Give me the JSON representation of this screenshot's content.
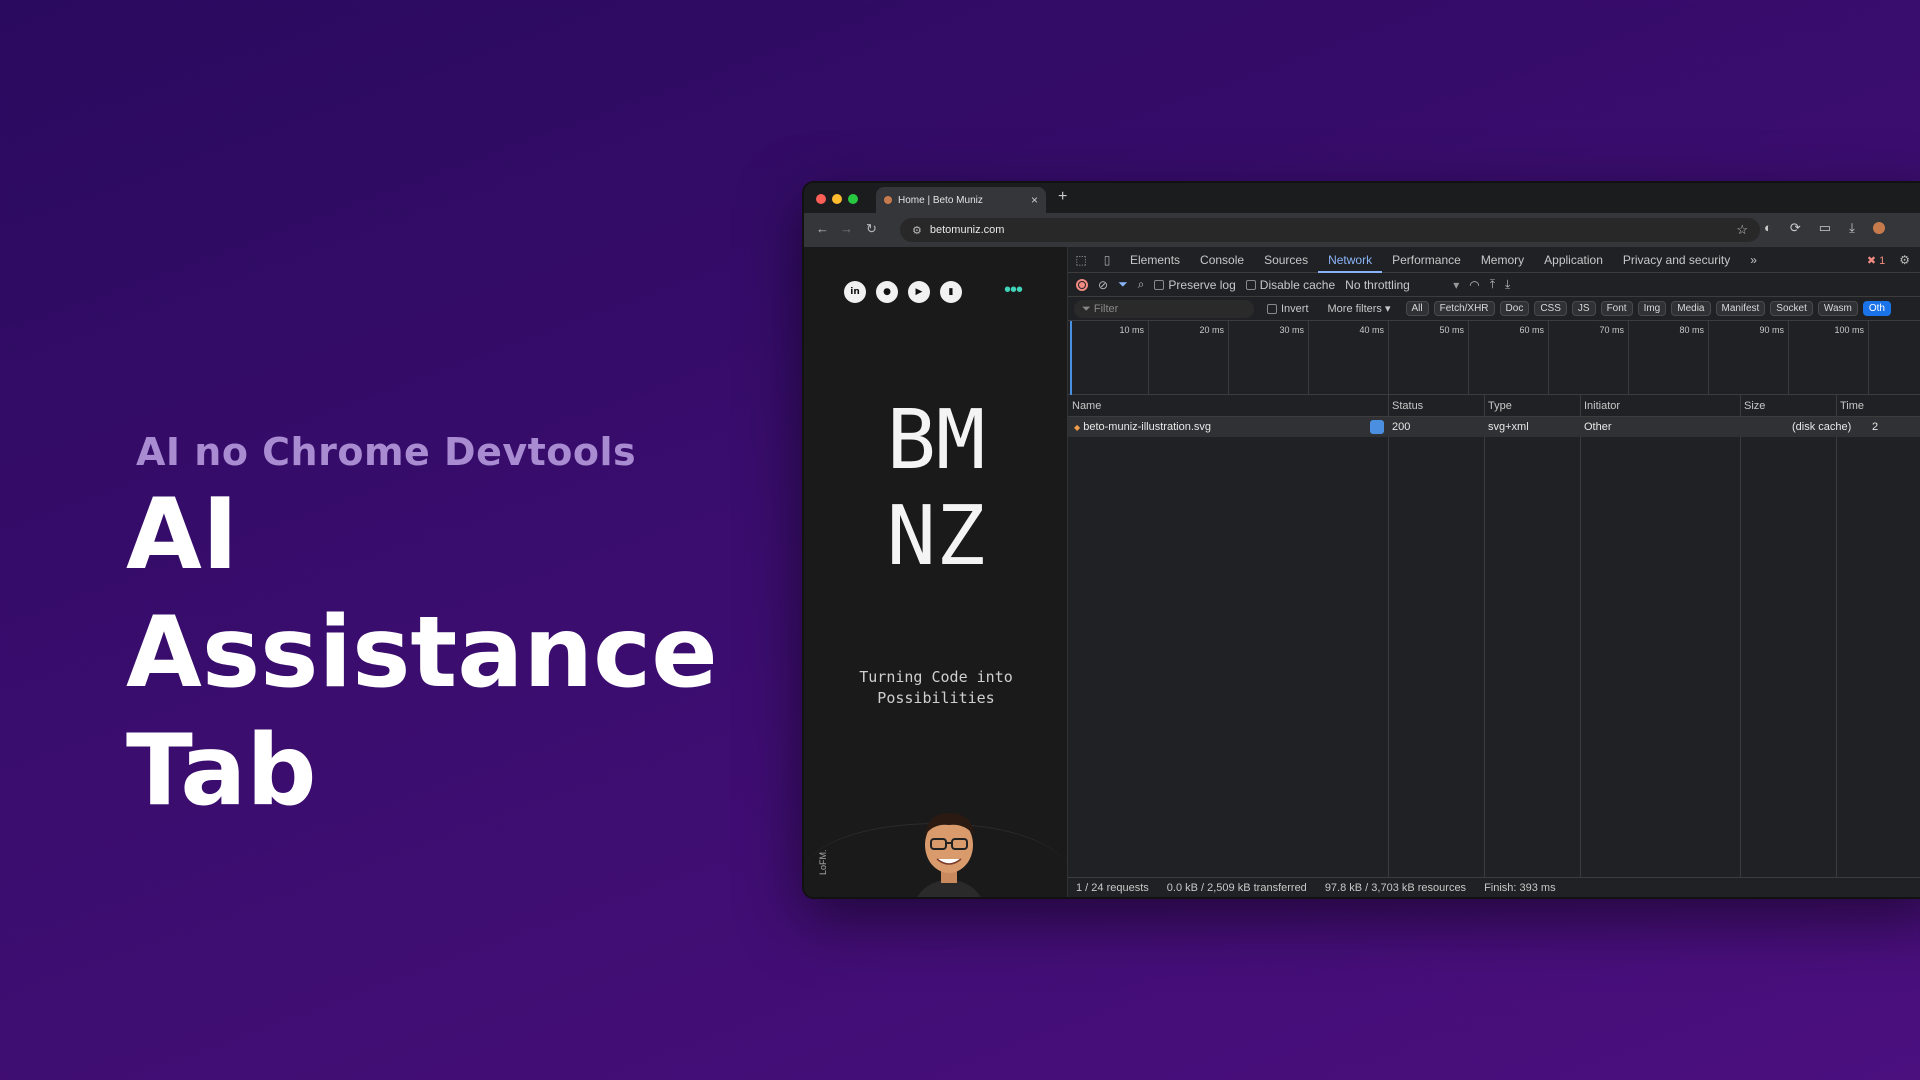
{
  "slide": {
    "subtitle": "AI no Chrome Devtools",
    "title_lines": [
      "AI",
      "Assistance",
      "Tab"
    ]
  },
  "browser": {
    "tab_title": "Home | Beto Muniz",
    "url": "betomuniz.com"
  },
  "site": {
    "social": [
      {
        "icon": "linkedin-icon",
        "glyph": "in"
      },
      {
        "icon": "github-icon",
        "glyph": "●"
      },
      {
        "icon": "youtube-icon",
        "glyph": "▶"
      },
      {
        "icon": "bookmark-icon",
        "glyph": "▮"
      }
    ],
    "logo_line1": "BM",
    "logo_line2": "NZ",
    "tagline_line1": "Turning Code into",
    "tagline_line2": "Possibilities",
    "lofm": "LoFM."
  },
  "devtools": {
    "tabs": [
      "Elements",
      "Console",
      "Sources",
      "Network",
      "Performance",
      "Memory",
      "Application",
      "Privacy and security"
    ],
    "active_tab": "Network",
    "error_count": "1",
    "preserve_log": "Preserve log",
    "disable_cache": "Disable cache",
    "throttling": "No throttling",
    "filter_placeholder": "Filter",
    "invert": "Invert",
    "more_filters": "More filters",
    "chips": [
      "All",
      "Fetch/XHR",
      "Doc",
      "CSS",
      "JS",
      "Font",
      "Img",
      "Media",
      "Manifest",
      "Socket",
      "Wasm",
      "Oth"
    ],
    "timeline_labels": [
      "10 ms",
      "20 ms",
      "30 ms",
      "40 ms",
      "50 ms",
      "60 ms",
      "70 ms",
      "80 ms",
      "90 ms",
      "100 ms"
    ],
    "columns": [
      "Name",
      "Status",
      "Type",
      "Initiator",
      "Size",
      "Time"
    ],
    "rows": [
      {
        "name": "beto-muniz-illustration.svg",
        "status": "200",
        "type": "svg+xml",
        "initiator": "Other",
        "size": "(disk cache)",
        "time": "2"
      }
    ],
    "status_bar": {
      "requests": "1 / 24 requests",
      "transferred": "0.0 kB / 2,509 kB transferred",
      "resources": "97.8 kB / 3,703 kB resources",
      "finish": "Finish: 393 ms"
    }
  }
}
